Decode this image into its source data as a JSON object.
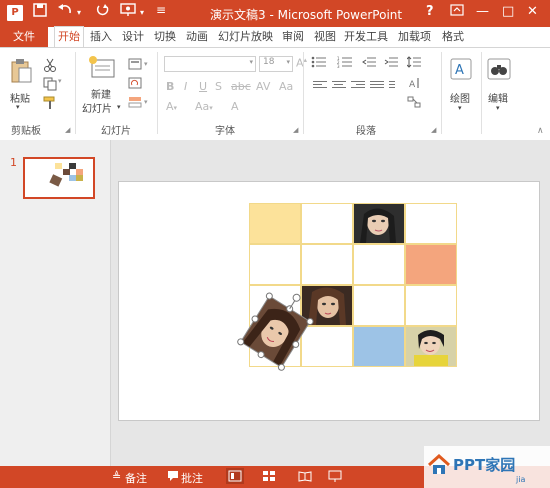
{
  "window": {
    "title": "演示文稿3 - Microsoft PowerPoint",
    "app_icon_letter": "P",
    "help_button": "?",
    "restore_icon": "restore-icon",
    "minimize_label": "—",
    "maximize_label": "□",
    "close_label": "✕"
  },
  "qat": {
    "save_icon": "save-icon",
    "undo_icon": "undo-icon",
    "redo_icon": "redo-icon",
    "present_icon": "present-icon"
  },
  "tabs": [
    {
      "label": "文件"
    },
    {
      "label": "开始"
    },
    {
      "label": "插入"
    },
    {
      "label": "设计"
    },
    {
      "label": "切换"
    },
    {
      "label": "动画"
    },
    {
      "label": "幻灯片放映"
    },
    {
      "label": "审阅"
    },
    {
      "label": "视图"
    },
    {
      "label": "开发工具"
    },
    {
      "label": "加载项"
    },
    {
      "label": "格式"
    }
  ],
  "ribbon": {
    "clipboard": {
      "paste": "粘贴",
      "group": "剪贴板"
    },
    "slides": {
      "new_slide_line1": "新建",
      "new_slide_line2": "幻灯片",
      "group": "幻灯片"
    },
    "font": {
      "size_value": "18",
      "group": "字体"
    },
    "paragraph": {
      "group": "段落"
    },
    "drawing": {
      "label": "绘图"
    },
    "editing": {
      "label": "编辑"
    }
  },
  "thumbnails": [
    {
      "number": "1"
    }
  ],
  "statusbar": {
    "notes": "备注",
    "comments": "批注"
  },
  "watermark": {
    "text": "PPT家园",
    "sub": "jia"
  },
  "colors": {
    "accent": "#d24726",
    "yellow": "#fce29a",
    "orange": "#f4a57d",
    "blue": "#9dc3e6",
    "grid_line": "#f2d98a"
  }
}
